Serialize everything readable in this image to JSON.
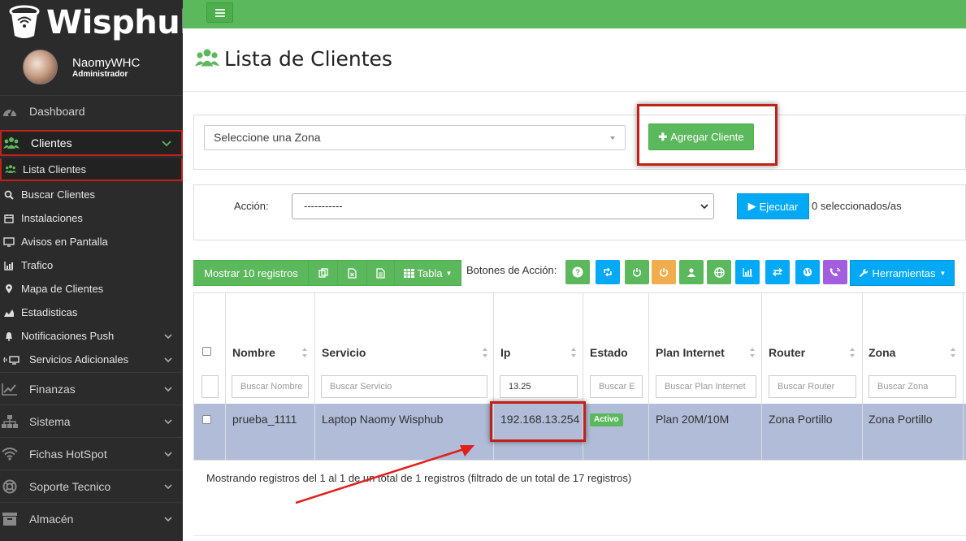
{
  "brand": {
    "name": "Wisphub"
  },
  "user": {
    "name": "NaomyWHC",
    "role": "Administrador"
  },
  "sidebar": {
    "main": [
      {
        "label": "Dashboard"
      },
      {
        "label": "Clientes"
      }
    ],
    "sub": [
      {
        "label": "Lista Clientes"
      },
      {
        "label": "Buscar Clientes"
      },
      {
        "label": "Instalaciones"
      },
      {
        "label": "Avisos en Pantalla"
      },
      {
        "label": "Trafico"
      },
      {
        "label": "Mapa de Clientes"
      },
      {
        "label": "Estadisticas"
      },
      {
        "label": "Notificaciones Push"
      },
      {
        "label": "Servicios Adicionales"
      }
    ],
    "groups": [
      {
        "label": "Finanzas"
      },
      {
        "label": "Sistema"
      },
      {
        "label": "Fichas HotSpot"
      },
      {
        "label": "Soporte Tecnico"
      },
      {
        "label": "Almacén"
      }
    ]
  },
  "page": {
    "title": "Lista de Clientes"
  },
  "zona": {
    "placeholder": "Seleccione una Zona",
    "add_button": "Agregar Cliente"
  },
  "accion": {
    "label": "Acción:",
    "selected": "-----------",
    "execute": "Ejecutar",
    "selected_count": "0 seleccionados/as"
  },
  "toolbar": {
    "show": "Mostrar 10 registros",
    "tabla": "Tabla",
    "actions_label": "Botones de Acción:",
    "tools": "Herramientas"
  },
  "table": {
    "headers": [
      "Nombre",
      "Servicio",
      "Ip",
      "Estado",
      "Plan Internet",
      "Router",
      "Zona"
    ],
    "filters": [
      "Buscar Nombre",
      "Buscar Servicio",
      "13.25",
      "Buscar E",
      "Buscar Plan Internet",
      "Buscar Router",
      "Buscar Zona"
    ],
    "row": {
      "nombre": "prueba_1111",
      "servicio": "Laptop Naomy Wisphub",
      "ip": "192.168.13.254",
      "estado": "Activo",
      "plan": "Plan 20M/10M",
      "router": "Zona Portillo",
      "zona": "Zona Portillo"
    }
  },
  "footer": {
    "info": "Mostrando registros del 1 al 1 de un total de 1 registros (filtrado de un total de 17 registros)"
  },
  "colors": {
    "green": "#5cb85c",
    "blue": "#03a9f4",
    "orange": "#f0ad4e",
    "purple": "#a35ee0",
    "sidebar": "#2b2b2b",
    "highlight": "#c0221a",
    "row": "#b0bcd8"
  }
}
